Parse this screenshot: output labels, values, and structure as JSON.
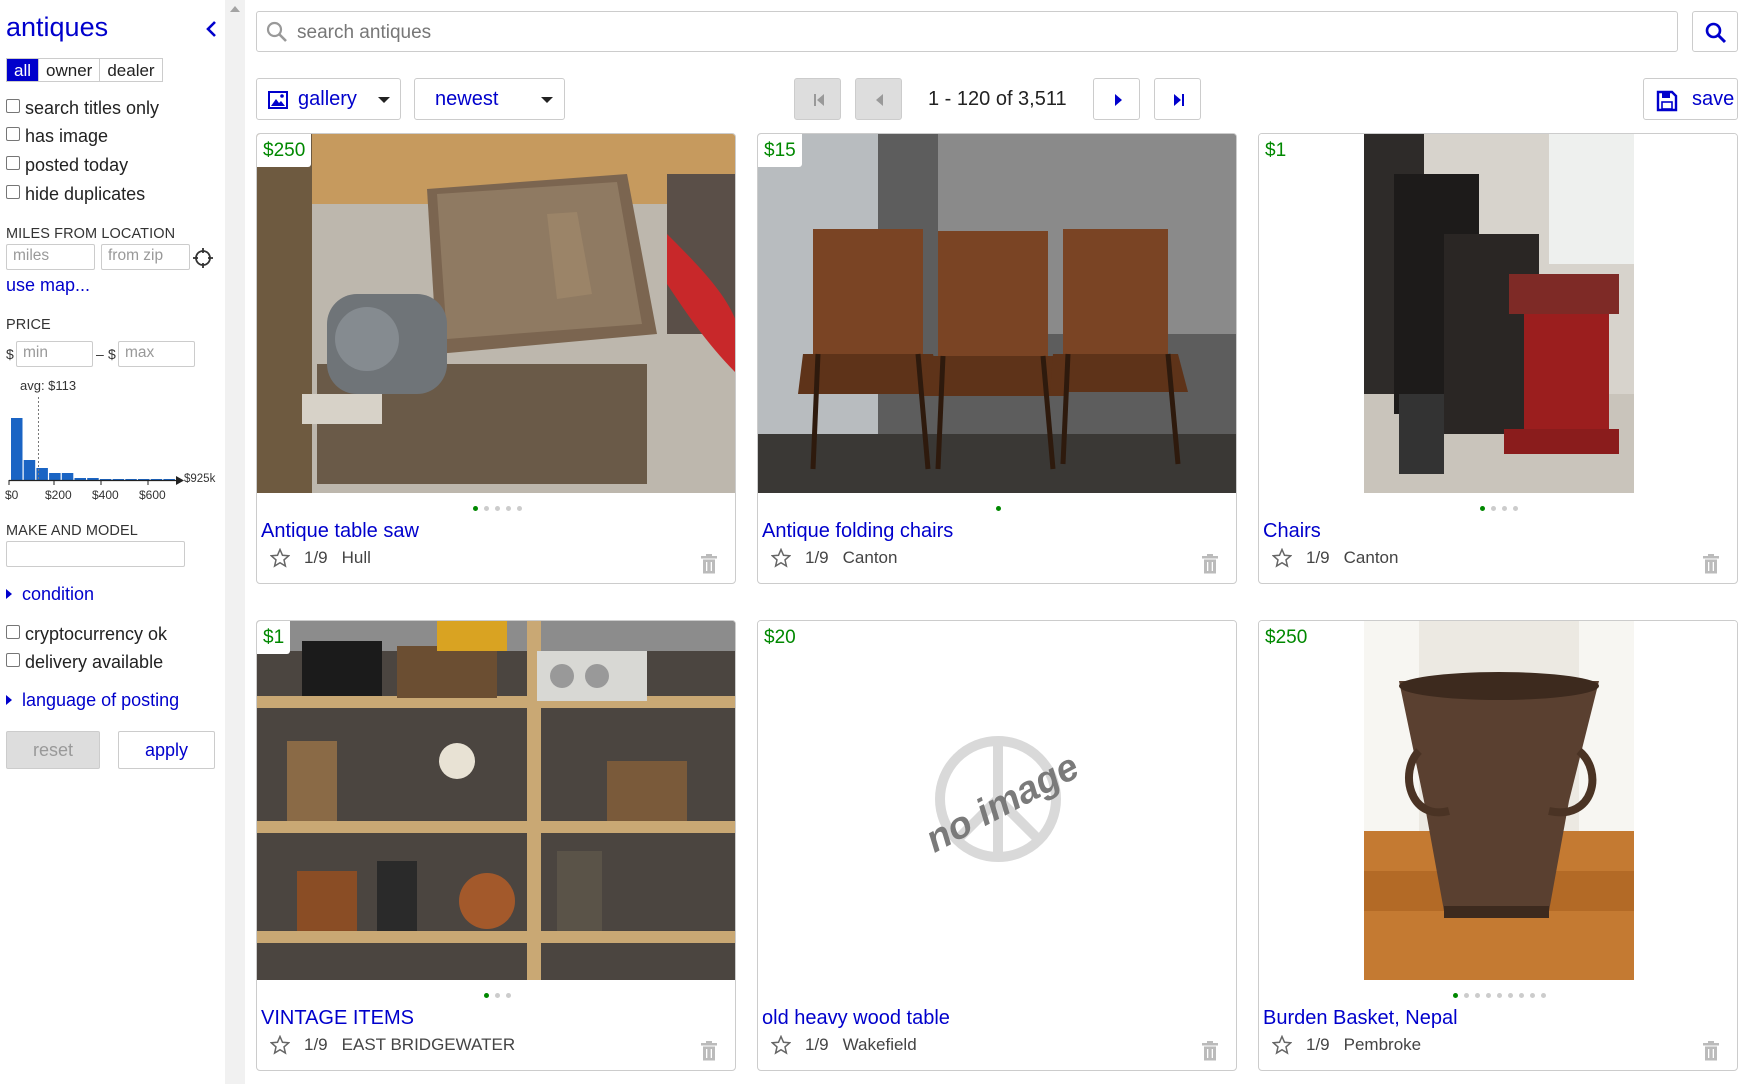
{
  "sidebar": {
    "title": "antiques",
    "seller_tabs": [
      "all",
      "owner",
      "dealer"
    ],
    "filters": [
      "search titles only",
      "has image",
      "posted today",
      "hide duplicates"
    ],
    "miles_label": "MILES FROM LOCATION",
    "miles_placeholder": "miles",
    "zip_placeholder": "from zip",
    "use_map": "use map...",
    "price_label": "PRICE",
    "currency": "$",
    "dash": "–",
    "min_placeholder": "min",
    "max_placeholder": "max",
    "make_model_label": "MAKE AND MODEL",
    "condition": "condition",
    "extra_filters": [
      "cryptocurrency ok",
      "delivery available"
    ],
    "language": "language of posting",
    "reset": "reset",
    "apply": "apply"
  },
  "histogram": {
    "avg_label": "avg: $113",
    "max_label": "$925k",
    "tick_labels": [
      "$0",
      "$200",
      "$400",
      "$600"
    ]
  },
  "chart_data": {
    "type": "bar",
    "values": [
      62,
      20,
      12,
      7,
      7,
      2,
      2,
      1,
      1,
      1,
      1,
      1,
      1
    ],
    "avg": 113,
    "color": "#1a64c4"
  },
  "search": {
    "placeholder": "search antiques"
  },
  "toolbar": {
    "view": "gallery",
    "sort": "newest",
    "range": "1 - 120 of 3,511",
    "save": "save"
  },
  "colors": {
    "link": "#0000cc",
    "price": "#008800",
    "active": "#0000cc"
  },
  "listings": [
    {
      "price": "$250",
      "title": "Antique table saw",
      "date": "1/9",
      "location": "Hull",
      "image_count": 5,
      "has_image": true
    },
    {
      "price": "$15",
      "title": "Antique folding chairs",
      "date": "1/9",
      "location": "Canton",
      "image_count": 1,
      "has_image": true
    },
    {
      "price": "$1",
      "title": "Chairs",
      "date": "1/9",
      "location": "Canton",
      "image_count": 4,
      "has_image": true
    },
    {
      "price": "$1",
      "title": "VINTAGE ITEMS",
      "date": "1/9",
      "location": "EAST BRIDGEWATER",
      "image_count": 3,
      "has_image": true
    },
    {
      "price": "$20",
      "title": "old heavy wood table",
      "date": "1/9",
      "location": "Wakefield",
      "image_count": 0,
      "has_image": false,
      "no_image_text": "no image"
    },
    {
      "price": "$250",
      "title": "Burden Basket, Nepal",
      "date": "1/9",
      "location": "Pembroke",
      "image_count": 9,
      "has_image": true
    }
  ]
}
